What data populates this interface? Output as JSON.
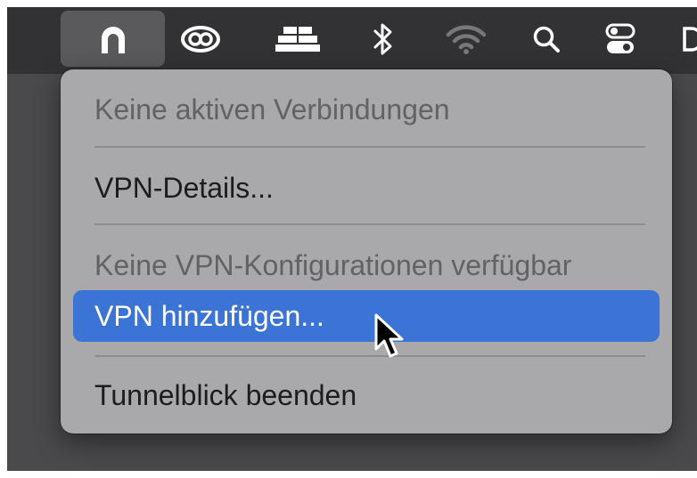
{
  "menubar": {
    "icons": [
      "tunnelblick-icon",
      "creative-cloud-icon",
      "dock-icon",
      "bluetooth-icon",
      "wifi-icon",
      "search-icon",
      "control-center-icon"
    ],
    "active_icon": "tunnelblick-icon"
  },
  "menu": {
    "status": "Keine aktiven Verbindungen",
    "details": "VPN-Details...",
    "no_configs": "Keine VPN-Konfigurationen verfügbar",
    "add_vpn": "VPN hinzufügen...",
    "quit": "Tunnelblick beenden"
  },
  "colors": {
    "menubar": "#323234",
    "menu_background": "#a9a9ab",
    "highlight": "#3c74d6"
  }
}
